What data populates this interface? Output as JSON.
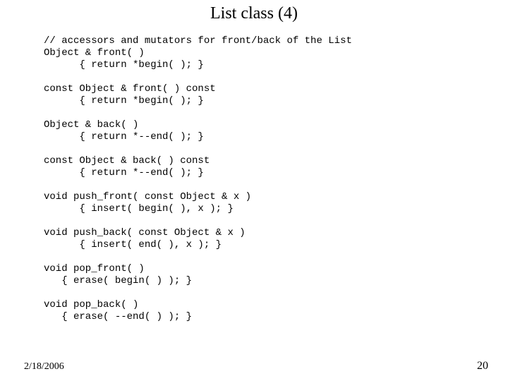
{
  "slide": {
    "title": "List class (4)",
    "date": "2/18/2006",
    "page_number": "20",
    "code_lines": [
      "// accessors and mutators for front/back of the List",
      "Object & front( )",
      "      { return *begin( ); }",
      "",
      "const Object & front( ) const",
      "      { return *begin( ); }",
      "",
      "Object & back( )",
      "      { return *--end( ); }",
      "",
      "const Object & back( ) const",
      "      { return *--end( ); }",
      "",
      "void push_front( const Object & x )",
      "      { insert( begin( ), x ); }",
      "",
      "void push_back( const Object & x )",
      "      { insert( end( ), x ); }",
      "",
      "void pop_front( )",
      "   { erase( begin( ) ); }",
      "",
      "void pop_back( )",
      "   { erase( --end( ) ); }"
    ]
  }
}
